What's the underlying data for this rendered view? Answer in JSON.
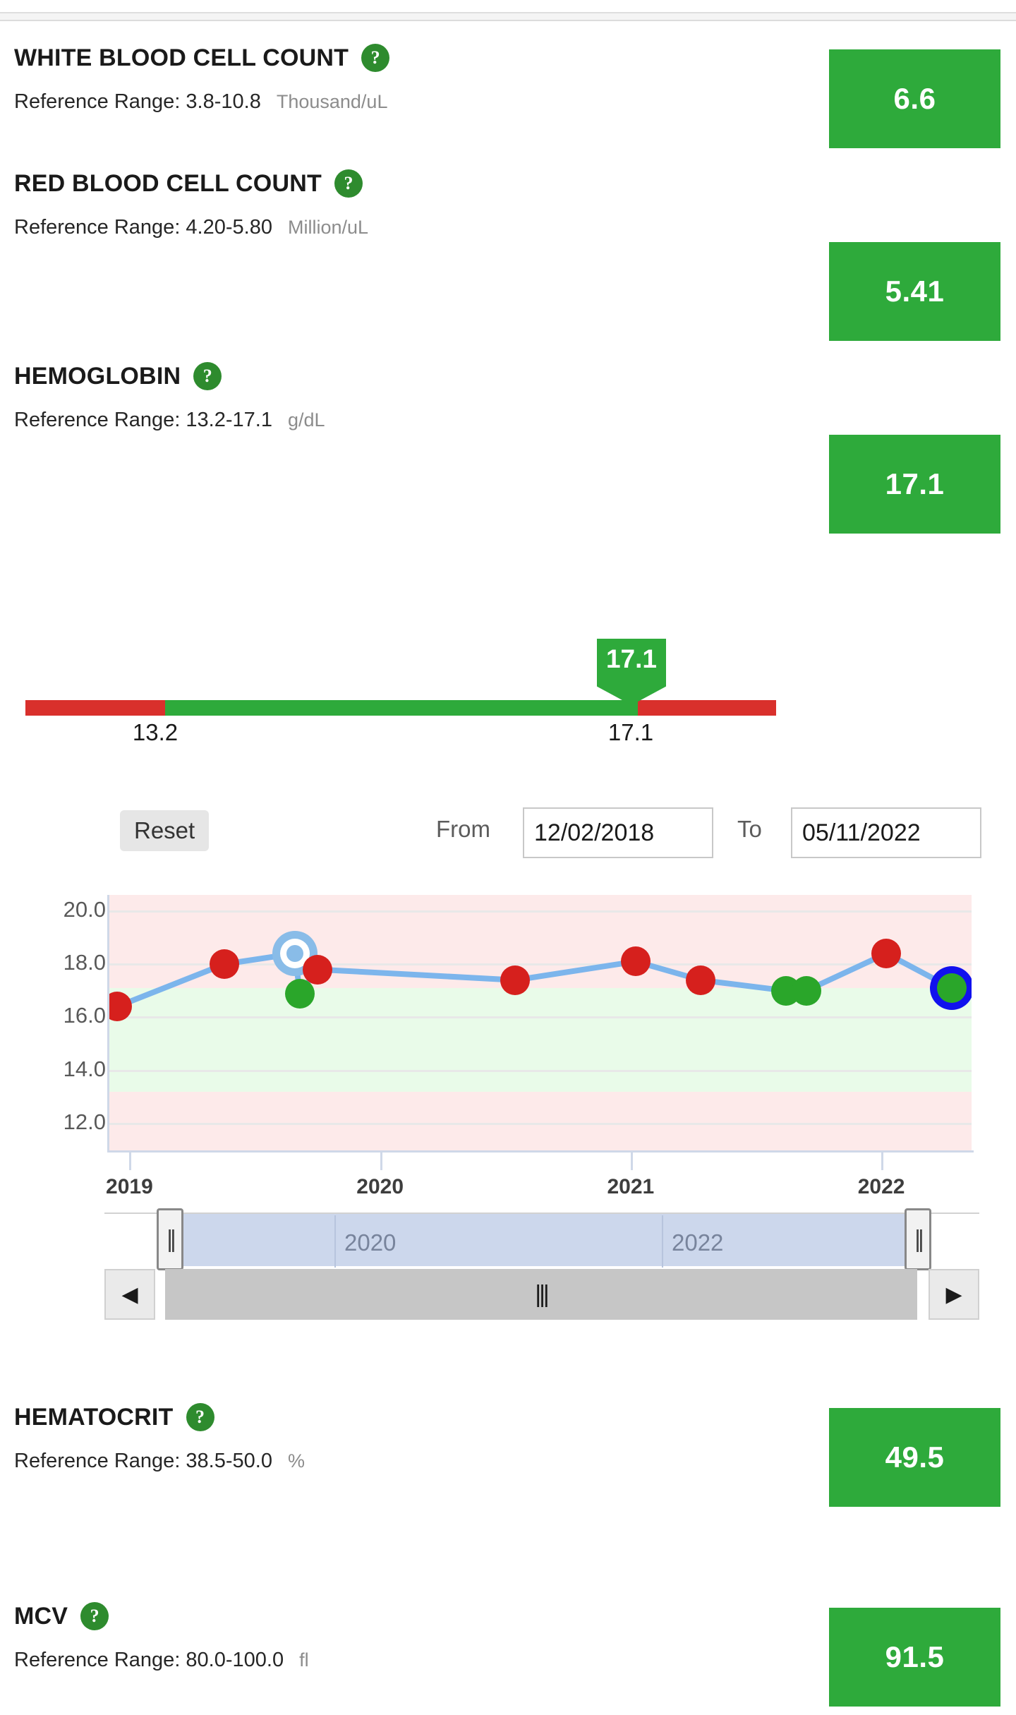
{
  "tests": [
    {
      "name": "WHITE BLOOD CELL COUNT",
      "help_icon": "question-mark-icon",
      "ref_label": "Reference Range: 3.8-10.8",
      "unit": "Thousand/uL",
      "value": "6.6",
      "status_color": "#2eaa3b"
    },
    {
      "name": "RED BLOOD CELL COUNT",
      "help_icon": "question-mark-icon",
      "ref_label": "Reference Range: 4.20-5.80",
      "unit": "Million/uL",
      "value": "5.41",
      "status_color": "#2eaa3b"
    },
    {
      "name": "HEMOGLOBIN",
      "help_icon": "question-mark-icon",
      "ref_label": "Reference Range: 13.2-17.1",
      "unit": "g/dL",
      "value": "17.1",
      "status_color": "#2eaa3b"
    },
    {
      "name": "HEMATOCRIT",
      "help_icon": "question-mark-icon",
      "ref_label": "Reference Range: 38.5-50.0",
      "unit": "%",
      "value": "49.5",
      "status_color": "#2eaa3b"
    },
    {
      "name": "MCV",
      "help_icon": "question-mark-icon",
      "ref_label": "Reference Range: 80.0-100.0",
      "unit": "fl",
      "value": "91.5",
      "status_color": "#2eaa3b"
    }
  ],
  "range_bar": {
    "marker_value": "17.1",
    "low_tick": "13.2",
    "high_tick": "17.1",
    "in_range_color": "#2eaa3b",
    "out_range_color": "#d9302c"
  },
  "chart_controls": {
    "reset_label": "Reset",
    "from_label": "From",
    "from_value": "12/02/2018",
    "to_label": "To",
    "to_value": "05/11/2022"
  },
  "navigator": {
    "year_left": "2020",
    "year_right": "2022",
    "left_arrow": "◀",
    "right_arrow": "▶",
    "grip": "|||",
    "handle_grip": "||"
  },
  "chart_data": {
    "type": "line",
    "title": "",
    "xlabel": "",
    "ylabel": "",
    "unit": "g/dL",
    "ylim": [
      11.0,
      20.6
    ],
    "yticks": [
      "20.0",
      "18.0",
      "16.0",
      "14.0",
      "12.0"
    ],
    "ytick_values": [
      20.0,
      18.0,
      16.0,
      14.0,
      12.0
    ],
    "xticks": [
      "2019",
      "2020",
      "2021",
      "2022"
    ],
    "xtick_values": [
      2019.0,
      2020.0,
      2021.0,
      2022.0
    ],
    "xlim": [
      2018.92,
      2022.36
    ],
    "grid": true,
    "legend": "none",
    "reference_band": {
      "low": 13.2,
      "high": 17.1,
      "in_color": "#e9fbe9",
      "out_color": "#fdeaea"
    },
    "line_color": "#7cb5ec",
    "series": [
      {
        "name": "Hemoglobin",
        "x": [
          2018.95,
          2019.38,
          2019.66,
          2019.68,
          2019.75,
          2020.54,
          2021.02,
          2021.28,
          2021.62,
          2021.7,
          2022.02,
          2022.28
        ],
        "values": [
          16.4,
          18.0,
          18.4,
          16.9,
          17.8,
          17.4,
          18.1,
          17.4,
          17.0,
          17.0,
          18.4,
          17.1
        ],
        "point_status": [
          "high",
          "high",
          "selected",
          "normal",
          "high",
          "high",
          "high",
          "high",
          "normal",
          "normal",
          "high",
          "latest-normal"
        ]
      }
    ]
  }
}
